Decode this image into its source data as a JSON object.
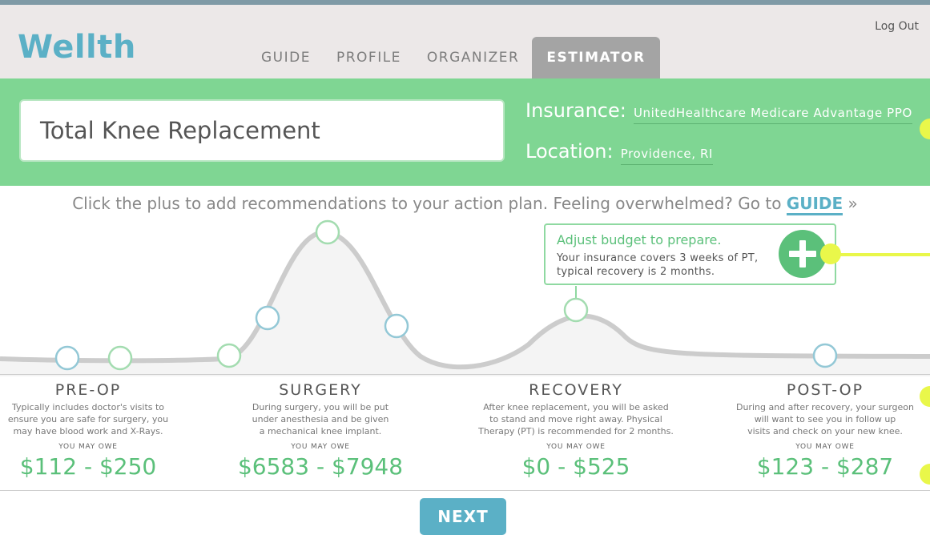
{
  "app": {
    "logo": "Wellth",
    "logout_label": "Log Out"
  },
  "nav": {
    "tabs": [
      {
        "label": "GUIDE"
      },
      {
        "label": "PROFILE"
      },
      {
        "label": "ORGANIZER"
      },
      {
        "label": "ESTIMATOR",
        "active": true
      }
    ]
  },
  "banner": {
    "procedure": "Total Knee Replacement",
    "insurance_label": "Insurance:",
    "insurance_value": "UnitedHealthcare Medicare Advantage PPO",
    "location_label": "Location:",
    "location_value": "Providence, RI"
  },
  "instruction": {
    "text": "Click the plus to add recommendations to your action plan. Feeling overwhelmed? Go to",
    "link": "GUIDE",
    "suffix": "»"
  },
  "callout": {
    "title": "Adjust budget to prepare.",
    "body": "Your insurance covers 3 weeks of PT, typical recovery is 2 months.",
    "button_icon": "plus-icon"
  },
  "phases": [
    {
      "title": "PRE-OP",
      "description": "Typically includes doctor's visits to\nensure you are safe for surgery, you\nmay have blood work and X-Rays.",
      "owe_label": "YOU MAY OWE",
      "price": "$112 - $250"
    },
    {
      "title": "SURGERY",
      "description": "During surgery, you will be put\nunder anesthesia and be given\na mechanical knee implant.",
      "owe_label": "YOU MAY OWE",
      "price": "$6583 - $7948"
    },
    {
      "title": "RECOVERY",
      "description": "After knee replacement, you will be asked\nto stand and move right away. Physical\nTherapy (PT) is recommended for 2 months.",
      "owe_label": "YOU MAY OWE",
      "price": "$0 - $525"
    },
    {
      "title": "POST-OP",
      "description": "During and after recovery, your surgeon\nwill want to see you in follow up\nvisits and check on your new knee.",
      "owe_label": "YOU MAY OWE",
      "price": "$123 - $287"
    }
  ],
  "next_label": "NEXT",
  "colors": {
    "brand_blue": "#5bb0c6",
    "green": "#7fd693",
    "price_green": "#5bc07a",
    "highlight_yellow": "#e9f74a",
    "curve_gray": "#cccccc"
  }
}
